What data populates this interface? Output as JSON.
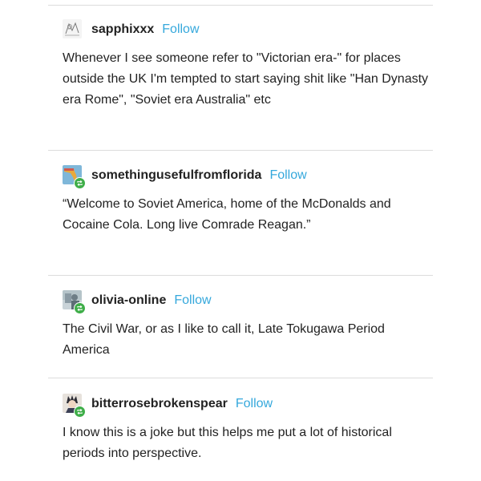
{
  "posts": [
    {
      "username": "sapphixxx",
      "follow_label": "Follow",
      "avatar_icon": "sketch-avatar-icon",
      "reblogged": false,
      "text": "Whenever I see someone refer to \"Victorian era-\" for places outside the UK I'm tempted to start saying shit like \"Han Dynasty era Rome\", \"Soviet era Australia\" etc"
    },
    {
      "username": "somethingusefulfromflorida",
      "follow_label": "Follow",
      "avatar_icon": "florida-map-avatar-icon",
      "reblogged": true,
      "text": "“Welcome to Soviet America, home of the McDonalds and Cocaine Cola.  Long live Comrade Reagan.”"
    },
    {
      "username": "olivia-online",
      "follow_label": "Follow",
      "avatar_icon": "photo-avatar-icon",
      "reblogged": true,
      "text": "The Civil War, or as I like to call it, Late Tokugawa Period America"
    },
    {
      "username": "bitterrosebrokenspear",
      "follow_label": "Follow",
      "avatar_icon": "character-avatar-icon",
      "reblogged": true,
      "text": "I know this is a joke but this helps me put a lot of historical periods into perspective."
    }
  ],
  "colors": {
    "follow": "#35a8dc",
    "reblog_badge": "#3fae49",
    "divider": "#dcdcdc",
    "text": "#222222"
  }
}
